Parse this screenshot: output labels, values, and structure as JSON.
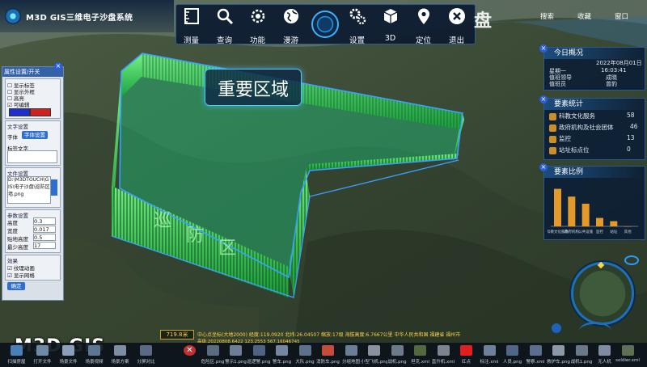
{
  "app": {
    "title": "M3D GIS三维电子沙盘系统",
    "title_tail": "盘",
    "brand": "M3D GIS"
  },
  "toolbar": {
    "items": [
      {
        "label": "测量",
        "icon": "ruler-icon"
      },
      {
        "label": "查询",
        "icon": "search-icon"
      },
      {
        "label": "功能",
        "icon": "gear-brain-icon"
      },
      {
        "label": "漫游",
        "icon": "globe-icon"
      },
      {
        "label": "",
        "icon": "roam-dial-icon"
      },
      {
        "label": "设置",
        "icon": "settings-icon"
      },
      {
        "label": "3D",
        "icon": "cube-icon"
      },
      {
        "label": "定位",
        "icon": "location-pin-icon"
      },
      {
        "label": "退出",
        "icon": "close-icon"
      }
    ]
  },
  "top_right": {
    "search": "搜索",
    "favorite": "收藏",
    "window": "窗口"
  },
  "scene": {
    "zone_label": "重要区域",
    "fence_text": "巡防区"
  },
  "today": {
    "title": "今日概况",
    "date": "2022年08月01日",
    "weekday": "星期一",
    "time": "16:03:41",
    "duty_leader_label": "值班领导",
    "duty_leader": "成晓",
    "duty_staff_label": "值班员",
    "duty_staff": "曾豹"
  },
  "stats": {
    "title": "要素统计",
    "rows": [
      {
        "label": "科教文化服务",
        "value": "58"
      },
      {
        "label": "政府机构及社会团体",
        "value": "46"
      },
      {
        "label": "监控",
        "value": "13"
      },
      {
        "label": "站址标点位",
        "value": "0"
      }
    ]
  },
  "ratio": {
    "title": "要素比例",
    "bars": [
      58,
      46,
      35,
      13,
      8,
      0
    ],
    "labels": [
      "科教文化服务",
      "政府机构",
      "公共设施",
      "监控",
      "站址",
      "其他"
    ]
  },
  "left_panel": {
    "title": "属性设置/开关",
    "checks": [
      "显示标签",
      "显示外框",
      "高亮",
      "可编辑"
    ],
    "group1": "文字设置",
    "font_label": "字体",
    "font_button": "字体设置",
    "label_text": "标签文字",
    "group2": "文件设置",
    "path": "D:\\M3DTOUCH\\GIS\\电子沙盘\\巡防区墙.png",
    "group3": "参数设置",
    "params": [
      {
        "label": "高度",
        "value": "0.3"
      },
      {
        "label": "宽度",
        "value": "0.017"
      },
      {
        "label": "贴地高度",
        "value": "0.5"
      },
      {
        "label": "最少高度",
        "value": "17"
      }
    ],
    "group4": "效果",
    "effects": [
      "纹理动画",
      "显示网格"
    ],
    "ok": "确定"
  },
  "status": {
    "height": "719.8米",
    "line1": "中心点坐标(大地2000) 经度:119.0920 北纬:26.04507 缩放:17级 海拔高度:6.7667公里 中华人民共和国 福建省 福州市",
    "line2": "高级:20220808.6422 123.2553 567.16046745"
  },
  "bottom_bar": [
    {
      "label": "扫描房屋",
      "color": "#4a7fb8"
    },
    {
      "label": "打开文件",
      "color": "#6f8aa6"
    },
    {
      "label": "场景文件",
      "color": "#8aa0b8"
    },
    {
      "label": "场景视频",
      "color": "#5c7694"
    },
    {
      "label": "场景方案",
      "color": "#7c8ea4"
    },
    {
      "label": "分屏对比",
      "color": "#596a82"
    },
    {
      "label": "",
      "color": "#c42f2f"
    },
    {
      "label": "危险区.png",
      "color": "#5a6c80"
    },
    {
      "label": "警示1.png",
      "color": "#6e7f95"
    },
    {
      "label": "巡逻警.png",
      "color": "#4e6480"
    },
    {
      "label": "警车.png",
      "color": "#7486a0"
    },
    {
      "label": "大队.png",
      "color": "#5d718b"
    },
    {
      "label": "消防车.png",
      "color": "#c54b3b"
    },
    {
      "label": "分组地图",
      "color": "#6a7e98"
    },
    {
      "label": "小型飞机.png",
      "color": "#88939f"
    },
    {
      "label": "战机.png",
      "color": "#6c7a8a"
    },
    {
      "label": "坦克.xml",
      "color": "#54683f"
    },
    {
      "label": "直升机.xml",
      "color": "#7a8493"
    },
    {
      "label": "红点",
      "color": "#e02020"
    },
    {
      "label": "标注.xml",
      "color": "#6f809a"
    },
    {
      "label": "人员.png",
      "color": "#506686"
    },
    {
      "label": "警察.xml",
      "color": "#5a6f8d"
    },
    {
      "label": "救护车.png",
      "color": "#8b98a6"
    },
    {
      "label": "战机1.png",
      "color": "#6b7889"
    },
    {
      "label": "无人机",
      "color": "#7e8ba0"
    },
    {
      "label": "soldier.xml",
      "color": "#5f6f55"
    }
  ]
}
